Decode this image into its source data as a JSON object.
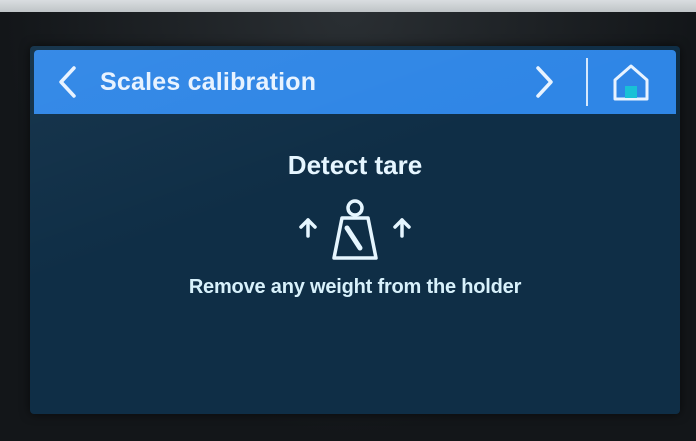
{
  "header": {
    "title": "Scales calibration",
    "back_icon": "chevron-left-icon",
    "next_icon": "chevron-right-icon",
    "home_icon": "home-icon"
  },
  "main": {
    "heading": "Detect tare",
    "illustration_icon": "weight-removal-icon",
    "message": "Remove any weight from the holder"
  },
  "colors": {
    "header_bg": "#2f86e6",
    "screen_bg": "#0f2e46",
    "text": "#e6f6ff"
  }
}
